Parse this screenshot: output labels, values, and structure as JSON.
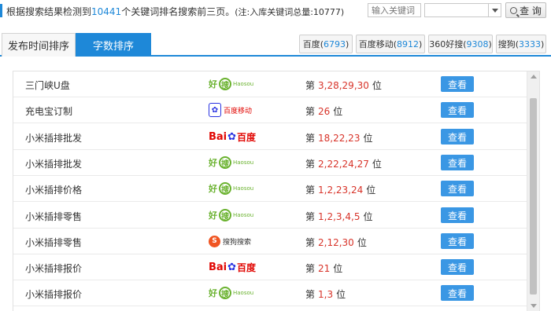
{
  "header": {
    "summary_prefix": "根据搜索结果检测到",
    "keyword_count": "10441",
    "summary_suffix": "个关键词排名搜索前三页。",
    "note": "(注:入库关键词总量:10777)",
    "search_placeholder": "输入关键词",
    "select_value": "",
    "search_button": "查 询"
  },
  "tabs": [
    {
      "label": "发布时间排序",
      "active": false
    },
    {
      "label": "字数排序",
      "active": true
    }
  ],
  "engines": [
    {
      "name": "百度",
      "count": "6793"
    },
    {
      "name": "百度移动",
      "count": "8912"
    },
    {
      "name": "360好搜",
      "count": "9308"
    },
    {
      "name": "搜狗",
      "count": "3333"
    }
  ],
  "logos": {
    "haosou": {
      "hao": "好",
      "q": "搜",
      "en": "Haosou"
    },
    "baidu": {
      "bai": "Bai",
      "paw": "✿",
      "du": "百度"
    },
    "baidu_mobile": {
      "paw": "✿",
      "text": "百度移动"
    },
    "sogou": {
      "s": "S",
      "text": "搜狗搜索"
    }
  },
  "rows": [
    {
      "keyword": "三门峡U盘",
      "engine": "haosou",
      "prefix": "第",
      "positions": "3,28,29,30",
      "suffix": "位",
      "button": "查看"
    },
    {
      "keyword": "充电宝订制",
      "engine": "baidu_mobile",
      "prefix": "第",
      "positions": "26",
      "suffix": "位",
      "button": "查看"
    },
    {
      "keyword": "小米插排批发",
      "engine": "baidu",
      "prefix": "第",
      "positions": "18,22,23",
      "suffix": "位",
      "button": "查看"
    },
    {
      "keyword": "小米插排批发",
      "engine": "haosou",
      "prefix": "第",
      "positions": "2,22,24,27",
      "suffix": "位",
      "button": "查看"
    },
    {
      "keyword": "小米插排价格",
      "engine": "haosou",
      "prefix": "第",
      "positions": "1,2,23,24",
      "suffix": "位",
      "button": "查看"
    },
    {
      "keyword": "小米插排零售",
      "engine": "haosou",
      "prefix": "第",
      "positions": "1,2,3,4,5",
      "suffix": "位",
      "button": "查看"
    },
    {
      "keyword": "小米插排零售",
      "engine": "sogou",
      "prefix": "第",
      "positions": "2,12,30",
      "suffix": "位",
      "button": "查看"
    },
    {
      "keyword": "小米插排报价",
      "engine": "baidu",
      "prefix": "第",
      "positions": "21",
      "suffix": "位",
      "button": "查看"
    },
    {
      "keyword": "小米插排报价",
      "engine": "haosou",
      "prefix": "第",
      "positions": "1,3",
      "suffix": "位",
      "button": "查看"
    }
  ]
}
